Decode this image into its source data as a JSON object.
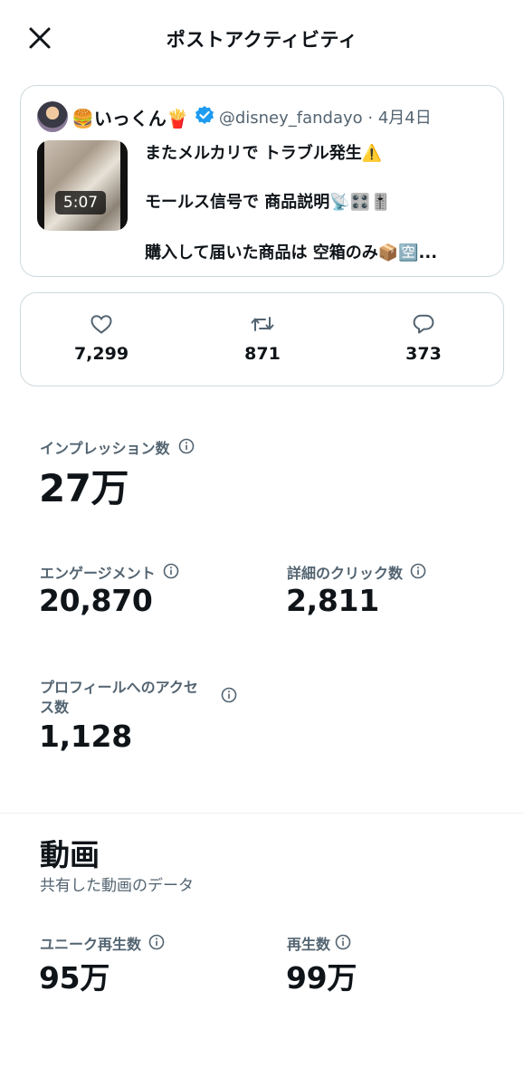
{
  "header": {
    "title": "ポストアクティビティ",
    "close_icon": "close-icon"
  },
  "post": {
    "author_name": "🍔いっくん🍟",
    "handle_date": "@disney_fandayo · 4月4日",
    "video_duration": "5:07",
    "lines": [
      "またメルカリで トラブル発生⚠️",
      "モールス信号で 商品説明📡🎛️🎚️",
      "購入して届いた商品は 空箱のみ📦🈳..."
    ],
    "verified_color": "#1d9bf0"
  },
  "engagement": {
    "likes": "7,299",
    "reposts": "871",
    "replies": "373"
  },
  "metrics": {
    "impressions_label": "インプレッション数",
    "impressions_value": "27万",
    "engagements_label": "エンゲージメント",
    "engagements_value": "20,870",
    "detail_clicks_label": "詳細のクリック数",
    "detail_clicks_value": "2,811",
    "profile_visits_label_1": "プロフィールへのアクセ",
    "profile_visits_label_2": "ス数",
    "profile_visits_value": "1,128"
  },
  "video": {
    "title": "動画",
    "subtitle": "共有した動画のデータ",
    "unique_views_label": "ユニーク再生数",
    "unique_views_value": "95万",
    "views_label": "再生数",
    "views_value": "99万"
  }
}
